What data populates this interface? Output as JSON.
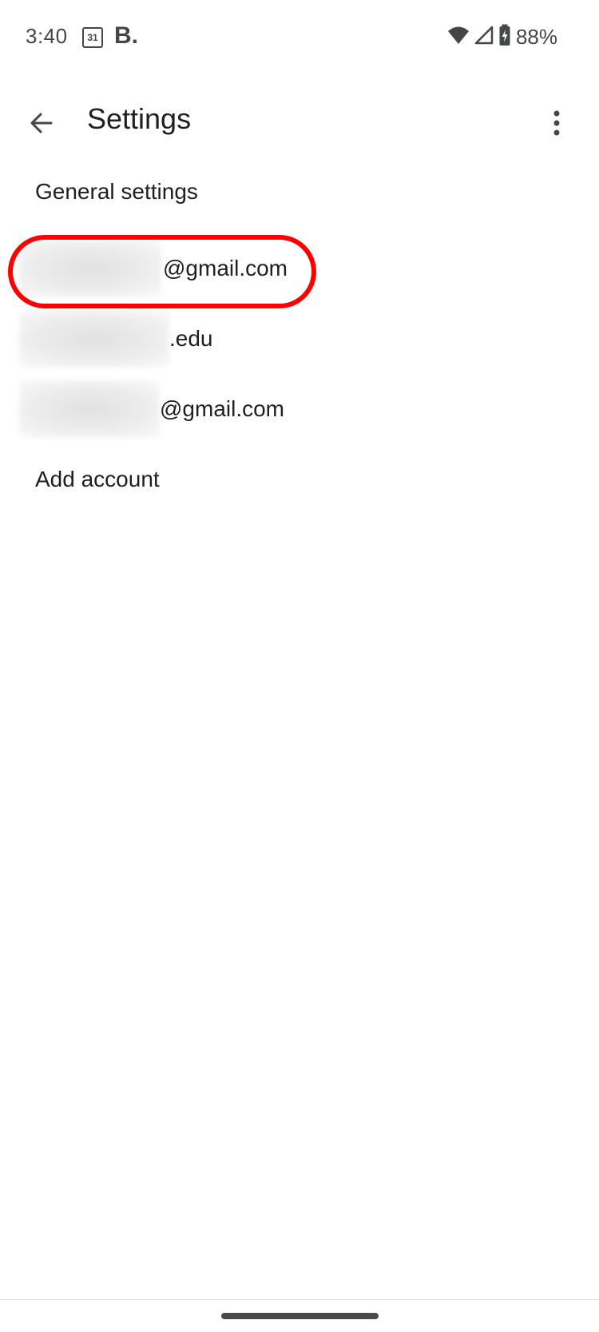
{
  "status_bar": {
    "time": "3:40",
    "calendar_day": "31",
    "b_badge": "B.",
    "battery": "88%",
    "icons": [
      "wifi-icon",
      "signal-icon",
      "battery-charging-icon"
    ]
  },
  "app_bar": {
    "title": "Settings",
    "back_icon": "arrow-back-icon",
    "more_icon": "more-vert-icon"
  },
  "list": {
    "general": "General settings",
    "accounts": [
      {
        "suffix": "@gmail.com",
        "highlighted": true
      },
      {
        "suffix": ".edu",
        "highlighted": false
      },
      {
        "suffix": "@gmail.com",
        "highlighted": false
      }
    ],
    "add_account": "Add account"
  },
  "colors": {
    "highlight": "#ff0000",
    "text": "#1f1f1f",
    "icon": "#444746"
  }
}
